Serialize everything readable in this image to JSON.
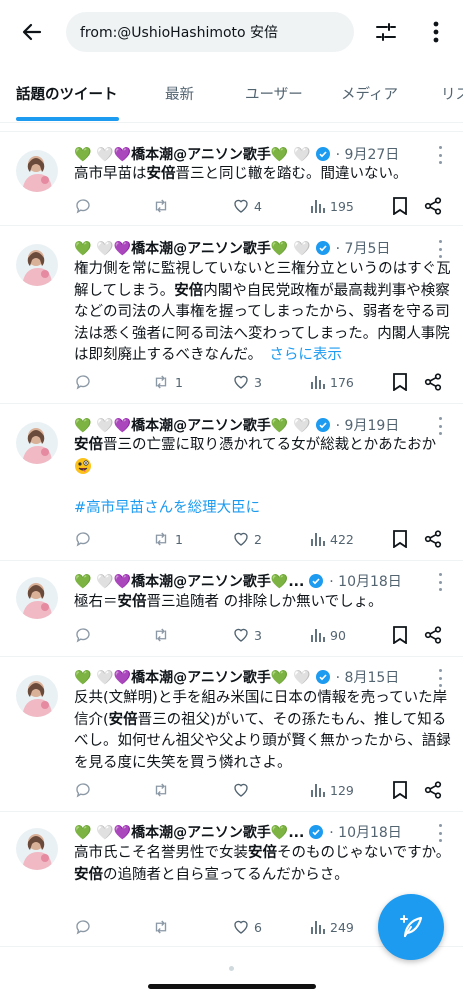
{
  "search": {
    "query": "from:@UshioHashimoto 安倍"
  },
  "tabs": [
    {
      "label": "話題のツイート",
      "active": true
    },
    {
      "label": "最新",
      "active": false
    },
    {
      "label": "ユーザー",
      "active": false
    },
    {
      "label": "メディア",
      "active": false
    },
    {
      "label": "リス",
      "active": false
    }
  ],
  "author": {
    "name_full": "💚 🤍💜橋本潮@アニソン歌手💚 🤍",
    "name_cut": "💚 🤍💜橋本潮@アニソン歌手💚...",
    "verified_color": "#1d9bf0"
  },
  "tweets": [
    {
      "date": "· 9月27日",
      "text": [
        "高市早苗は",
        "安倍",
        "晋三と同じ轍を踏む。間違いない。"
      ],
      "reply": "",
      "retweet": "",
      "like": "4",
      "views": "195"
    },
    {
      "date": "· 7月5日",
      "text": [
        "権力側を常に監視していないと三権分立というのはすぐ瓦解してしまう。",
        "安倍",
        "内閣や自民党政権が最高裁判事や検察などの司法の人事権を握ってしまったから、弱者を守る司法は悉く強者に阿る司法へ変わってしまった。内閣人事院は即刻廃止するべきなんだ。",
        "さらに表示"
      ],
      "reply": "",
      "retweet": "1",
      "like": "3",
      "views": "176"
    },
    {
      "date": "· 9月19日",
      "text": [
        "安倍",
        "晋三の亡霊に取り憑かれてる女が総裁とかあたおか",
        "#高市早苗さんを総理大臣に"
      ],
      "reply": "",
      "retweet": "1",
      "like": "2",
      "views": "422"
    },
    {
      "date": "· 10月18日",
      "text": [
        "極右＝",
        "安倍",
        "晋三追随者 の排除しか無いでしょ。"
      ],
      "reply": "",
      "retweet": "",
      "like": "3",
      "views": "90"
    },
    {
      "date": "· 8月15日",
      "text": [
        "反共(文鮮明)と手を組み米国に日本の情報を売っていた岸信介(",
        "安倍",
        "晋三の祖父)がいて、その孫たもん、推して知るべし。如何せん祖父や父より頭が賢く無かったから、語録を見る度に失笑を買う憐れさよ。"
      ],
      "reply": "",
      "retweet": "",
      "like": "",
      "views": "129"
    },
    {
      "date": "· 10月18日",
      "text": [
        "高市氏こそ名誉男性で女装",
        "安倍",
        "そのものじゃないですか。",
        "安倍",
        "の追随者と自ら宣ってるんだからさ。"
      ],
      "reply": "",
      "retweet": "",
      "like": "6",
      "views": "249"
    }
  ],
  "colors": {
    "accent": "#1d9bf0",
    "muted": "#536471",
    "divider": "#eff3f4"
  }
}
